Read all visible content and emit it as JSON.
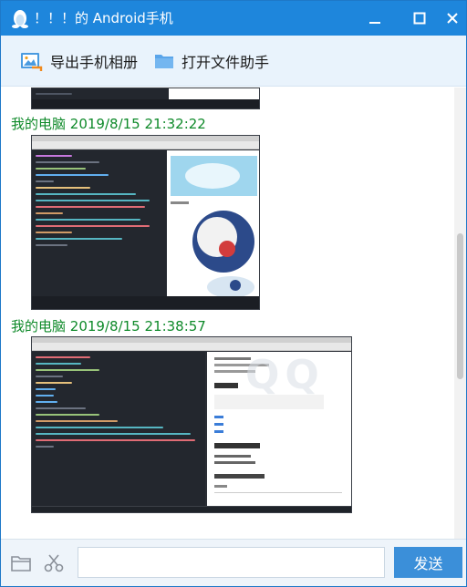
{
  "window": {
    "title": "！！！的 Android手机",
    "accent_color": "#1e86dc",
    "controls": [
      "minimize-icon",
      "maximize-icon",
      "close-icon"
    ]
  },
  "toolbar": {
    "export_album_label": "导出手机相册",
    "export_album_icon": "image-export-icon",
    "open_assistant_label": "打开文件助手",
    "open_assistant_icon": "folder-icon"
  },
  "chat": {
    "watermark": "QQ",
    "sender_color": "#0f8a2a",
    "messages": [
      {
        "sender": "我的电脑",
        "time": "2019/8/15 21:32:22",
        "content": "image"
      },
      {
        "sender": "我的电脑",
        "time": "2019/8/15 21:38:57",
        "content": "image"
      }
    ]
  },
  "inputbar": {
    "folder_icon": "folder-icon",
    "scissors_icon": "scissors-icon",
    "input_value": "",
    "send_label": "发送"
  }
}
